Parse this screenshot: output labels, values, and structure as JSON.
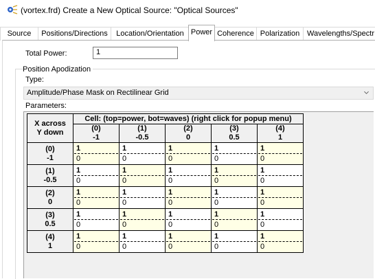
{
  "window": {
    "title": "(vortex.frd) Create a New Optical Source: \"Optical Sources\"",
    "icon": "optical-source-icon"
  },
  "tabs": [
    {
      "label": "Source",
      "active": false
    },
    {
      "label": "Positions/Directions",
      "active": false
    },
    {
      "label": "Location/Orientation",
      "active": false
    },
    {
      "label": "Power",
      "active": true
    },
    {
      "label": "Coherence",
      "active": false
    },
    {
      "label": "Polarization",
      "active": false
    },
    {
      "label": "Wavelengths/Spectr",
      "active": false
    }
  ],
  "power": {
    "total_power_label": "Total Power:",
    "total_power_value": "1"
  },
  "apodization": {
    "group_label": "Position Apodization",
    "type_label": "Type:",
    "type_value": "Amplitude/Phase Mask on Rectilinear Grid",
    "parameters_label": "Parameters:"
  },
  "grid": {
    "corner_label_1": "X across",
    "corner_label_2": "Y down",
    "caption": "Cell: (top=power, bot=waves)    (right click for popup menu)",
    "columns": [
      {
        "index": "(0)",
        "value": "-1"
      },
      {
        "index": "(1)",
        "value": "-0.5"
      },
      {
        "index": "(2)",
        "value": "0"
      },
      {
        "index": "(3)",
        "value": "0.5"
      },
      {
        "index": "(4)",
        "value": "1"
      }
    ],
    "rows": [
      {
        "index": "(0)",
        "value": "-1",
        "cells": [
          {
            "power": "1",
            "waves": "0"
          },
          {
            "power": "1",
            "waves": "0"
          },
          {
            "power": "1",
            "waves": "0"
          },
          {
            "power": "1",
            "waves": "0"
          },
          {
            "power": "1",
            "waves": "0"
          }
        ]
      },
      {
        "index": "(1)",
        "value": "-0.5",
        "cells": [
          {
            "power": "1",
            "waves": "0"
          },
          {
            "power": "1",
            "waves": "0"
          },
          {
            "power": "1",
            "waves": "0"
          },
          {
            "power": "1",
            "waves": "0"
          },
          {
            "power": "1",
            "waves": "0"
          }
        ]
      },
      {
        "index": "(2)",
        "value": "0",
        "cells": [
          {
            "power": "1",
            "waves": "0"
          },
          {
            "power": "1",
            "waves": "0"
          },
          {
            "power": "1",
            "waves": "0"
          },
          {
            "power": "1",
            "waves": "0"
          },
          {
            "power": "1",
            "waves": "0"
          }
        ]
      },
      {
        "index": "(3)",
        "value": "0.5",
        "cells": [
          {
            "power": "1",
            "waves": "0"
          },
          {
            "power": "1",
            "waves": "0"
          },
          {
            "power": "1",
            "waves": "0"
          },
          {
            "power": "1",
            "waves": "0"
          },
          {
            "power": "1",
            "waves": "0"
          }
        ]
      },
      {
        "index": "(4)",
        "value": "1",
        "cells": [
          {
            "power": "1",
            "waves": "0"
          },
          {
            "power": "1",
            "waves": "0"
          },
          {
            "power": "1",
            "waves": "0"
          },
          {
            "power": "1",
            "waves": "0"
          },
          {
            "power": "1",
            "waves": "0"
          }
        ]
      }
    ]
  },
  "colors": {
    "cell_highlight": "#ffffe6",
    "panel_bg": "#f0f0f0",
    "tab_border": "#adadad"
  }
}
